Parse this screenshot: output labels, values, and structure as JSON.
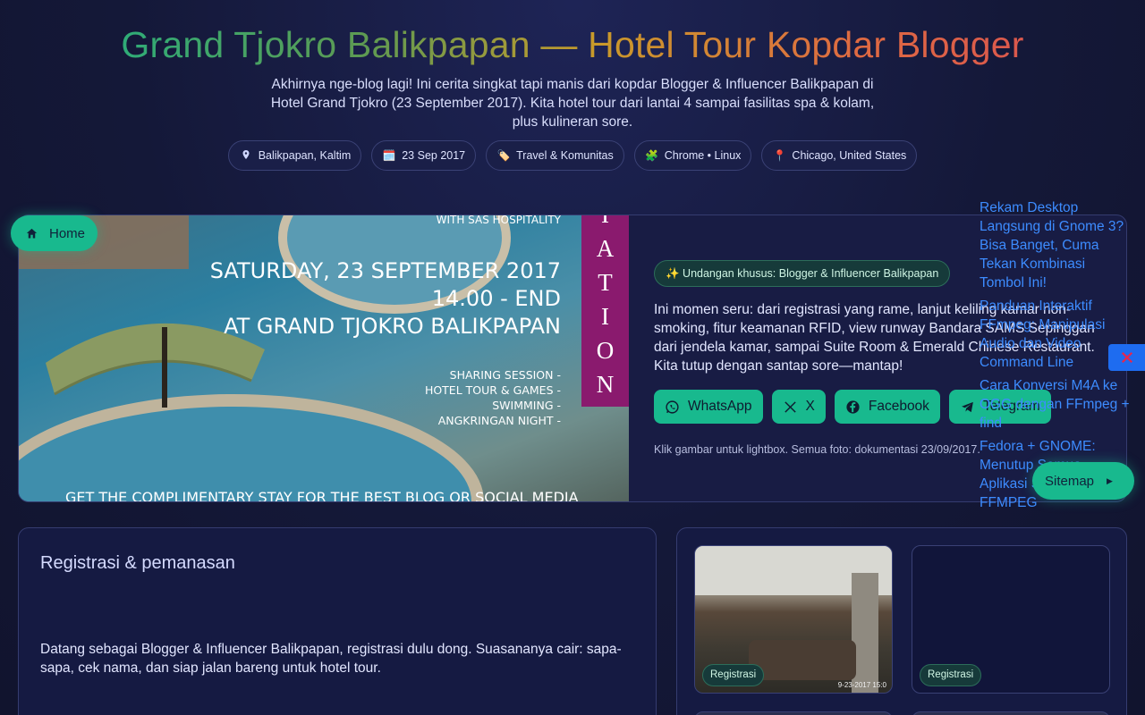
{
  "header": {
    "title": "Grand Tjokro Balikpapan — Hotel Tour Kopdar Blogger",
    "intro": "Akhirnya nge-blog lagi! Ini cerita singkat tapi manis dari kopdar Blogger & Influencer Balikpapan di Hotel Grand Tjokro (23 September 2017). Kita hotel tour dari lantai 4 sampai fasilitas spa & kolam, plus kulineran sore.",
    "chips": [
      {
        "icon": "map-pin-icon",
        "text": "Balikpapan, Kaltim"
      },
      {
        "icon": "calendar-icon",
        "glyph": "🗓️",
        "text": "23 Sep 2017"
      },
      {
        "icon": "tag-icon",
        "glyph": "🏷️",
        "text": "Travel & Komunitas"
      },
      {
        "icon": "puzzle-icon",
        "glyph": "🧩",
        "text": "Chrome • Linux"
      },
      {
        "icon": "location-pin-icon",
        "glyph": "📍",
        "text": "Chicago, United States"
      }
    ]
  },
  "nav": {
    "home_label": "Home",
    "sitemap_label": "Sitemap"
  },
  "hero": {
    "image_text": {
      "organizer": "WITH SAS HOSPITALITY",
      "date_line": "SATURDAY, 23 SEPTEMBER 2017",
      "time_line": "14.00 - END",
      "venue_line": "AT GRAND TJOKRO BALIKPAPAN",
      "agenda": [
        "SHARING SESSION -",
        "HOTEL TOUR & GAMES -",
        "SWIMMING -",
        "ANGKRINGAN NIGHT -"
      ],
      "banner_letters": [
        "I",
        "A",
        "T",
        "I",
        "O",
        "N"
      ],
      "bottom_line": "GET THE COMPLIMENTARY STAY FOR THE BEST BLOG OR SOCIAL MEDIA"
    },
    "badge": "✨ Undangan khusus: Blogger & Influencer Balikpapan",
    "description": "Ini momen seru: dari registrasi yang rame, lanjut keliling kamar non-smoking, fitur keamanan RFID, view runway Bandara SAMS Sepinggan dari jendela kamar, sampai Suite Room & Emerald Chinese Restaurant. Kita tutup dengan santap sore—mantap!",
    "share": [
      {
        "label": "WhatsApp",
        "icon": "whatsapp-icon"
      },
      {
        "label": "X",
        "icon": "x-icon"
      },
      {
        "label": "Facebook",
        "icon": "facebook-icon"
      },
      {
        "label": "Telegram",
        "icon": "telegram-icon"
      }
    ],
    "note": "Klik gambar untuk lightbox. Semua foto: dokumentasi 23/09/2017."
  },
  "sidebar_links": [
    "Rekam Desktop Langsung di Gnome 3? Bisa Banget, Cuma Tekan Kombinasi Tombol Ini!",
    "Panduan Interaktif FFmpeg: Manipulasi Audio dan Video Command Line",
    "Cara Konversi M4A ke OGG dengan FFmpeg + find",
    "Fedora + GNOME: Menutup Semua Aplikasi Screencast FFMPEG"
  ],
  "section": {
    "title": "Registrasi & pemanasan",
    "body": "Datang sebagai Blogger & Influencer Balikpapan, registrasi dulu dong. Suasananya cair: sapa-sapa, cek nama, dan siap jalan bareng untuk hotel tour.",
    "gallery": [
      {
        "tag": "Registrasi",
        "timestamp": "9-23-2017 15:0"
      },
      {
        "tag": "Registrasi"
      }
    ]
  },
  "colors": {
    "accent": "#18b98e",
    "link": "#3d8cff",
    "banner": "#8a1a6e",
    "close": "#1e6cf0"
  }
}
